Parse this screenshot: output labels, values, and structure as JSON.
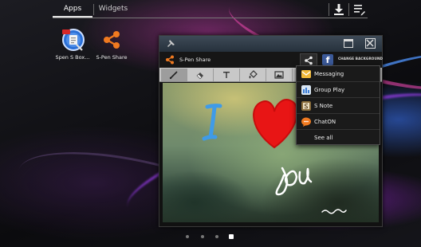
{
  "launcher": {
    "tabs": [
      {
        "label": "Apps",
        "selected": true
      },
      {
        "label": "Widgets",
        "selected": false
      }
    ],
    "apps": [
      {
        "label": "Spen S Box...",
        "icon": "spen-s-box-icon"
      },
      {
        "label": "S-Pen Share",
        "icon": "share-icon"
      }
    ],
    "page_count": 4,
    "current_page": 4
  },
  "window": {
    "app_title": "S-Pen Share",
    "change_background_label": "CHANGE BACKGROUND",
    "facebook_label": "f",
    "tools": [
      "pen-icon",
      "eraser-icon",
      "text-icon",
      "fill-icon",
      "image-icon"
    ],
    "active_tool": 0
  },
  "share_menu": {
    "items": [
      {
        "label": "Messaging",
        "icon": "envelope-icon",
        "color": "#f0b93a"
      },
      {
        "label": "Group Play",
        "icon": "group-play-icon",
        "color": "#d9e6f2"
      },
      {
        "label": "S Note",
        "icon": "s-note-icon",
        "color": "#8a6d3b"
      },
      {
        "label": "ChatON",
        "icon": "chaton-icon",
        "color": "#f07a20"
      }
    ],
    "see_all_label": "See all"
  },
  "drawing": {
    "handwriting_left": "I",
    "handwriting_right": "You",
    "colors": {
      "letter_i": "#3f9be8",
      "heart": "#e81515",
      "you": "#ffffff"
    }
  }
}
